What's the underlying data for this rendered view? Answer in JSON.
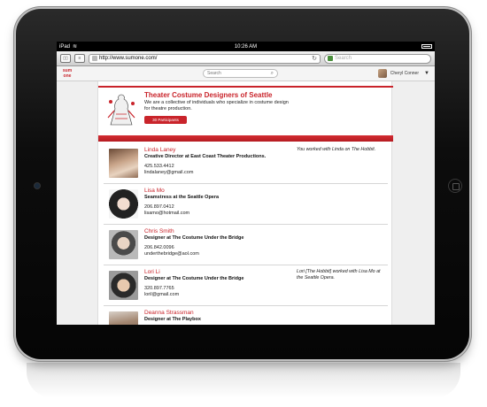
{
  "statusbar": {
    "carrier": "iPad",
    "time": "10:26 AM"
  },
  "browser": {
    "url": "http://www.sumone.com/",
    "search_placeholder": "Search",
    "reader_icon": "reader-icon"
  },
  "app": {
    "logo_line1": "sum",
    "logo_line2": "one",
    "search_placeholder": "Search",
    "user_name": "Cheryl Conner"
  },
  "group": {
    "title": "Theater Costume Designers of Seattle",
    "description": "We are a collective of individuals who specialize in costume design for theatre production.",
    "participants_label": "30 Participants"
  },
  "members": [
    {
      "name": "Linda Laney",
      "title": "Creative Director at East Coast Theater Productions.",
      "phone": "425.533.4412",
      "email": "lindalaney@gmail.com",
      "note": "You worked with Linda on The Hobbit."
    },
    {
      "name": "Lisa Mo",
      "title": "Seamstress at the Seattle Opera",
      "phone": "206.897.0412",
      "email": "lisamo@hotmail.com",
      "note": ""
    },
    {
      "name": "Chris Smith",
      "title": "Designer at The Costume Under the Bridge",
      "phone": "206.842.0096",
      "email": "underthebridge@aol.com",
      "note": ""
    },
    {
      "name": "Lori Li",
      "title": "Designer at The Costume Under the Bridge",
      "phone": "320.897.7765",
      "email": "loril@gmail.com",
      "note": "Lori [The Hobbit] worked with Lisa Mo at the Seattle Opera."
    },
    {
      "name": "Deanna Strassman",
      "title": "Designer at The Playbox",
      "phone": "",
      "email": "",
      "note": ""
    }
  ],
  "colors": {
    "accent": "#c9242b",
    "bezel": "#0d0d0d"
  }
}
